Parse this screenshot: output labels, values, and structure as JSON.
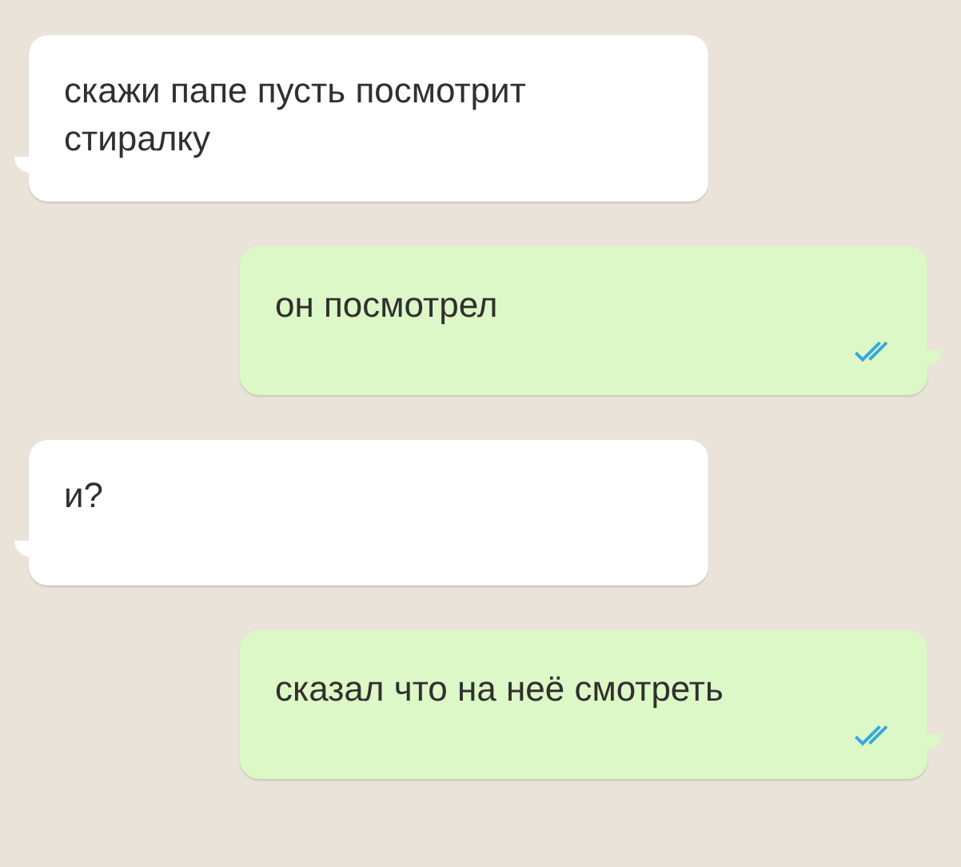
{
  "messages": [
    {
      "kind": "incoming",
      "text": "скажи папе пусть посмотрит стиралку"
    },
    {
      "kind": "outgoing",
      "text": "он посмотрел",
      "read": true
    },
    {
      "kind": "incoming",
      "text": "и?"
    },
    {
      "kind": "outgoing",
      "text": "сказал что на неё смотреть",
      "read": true
    }
  ]
}
